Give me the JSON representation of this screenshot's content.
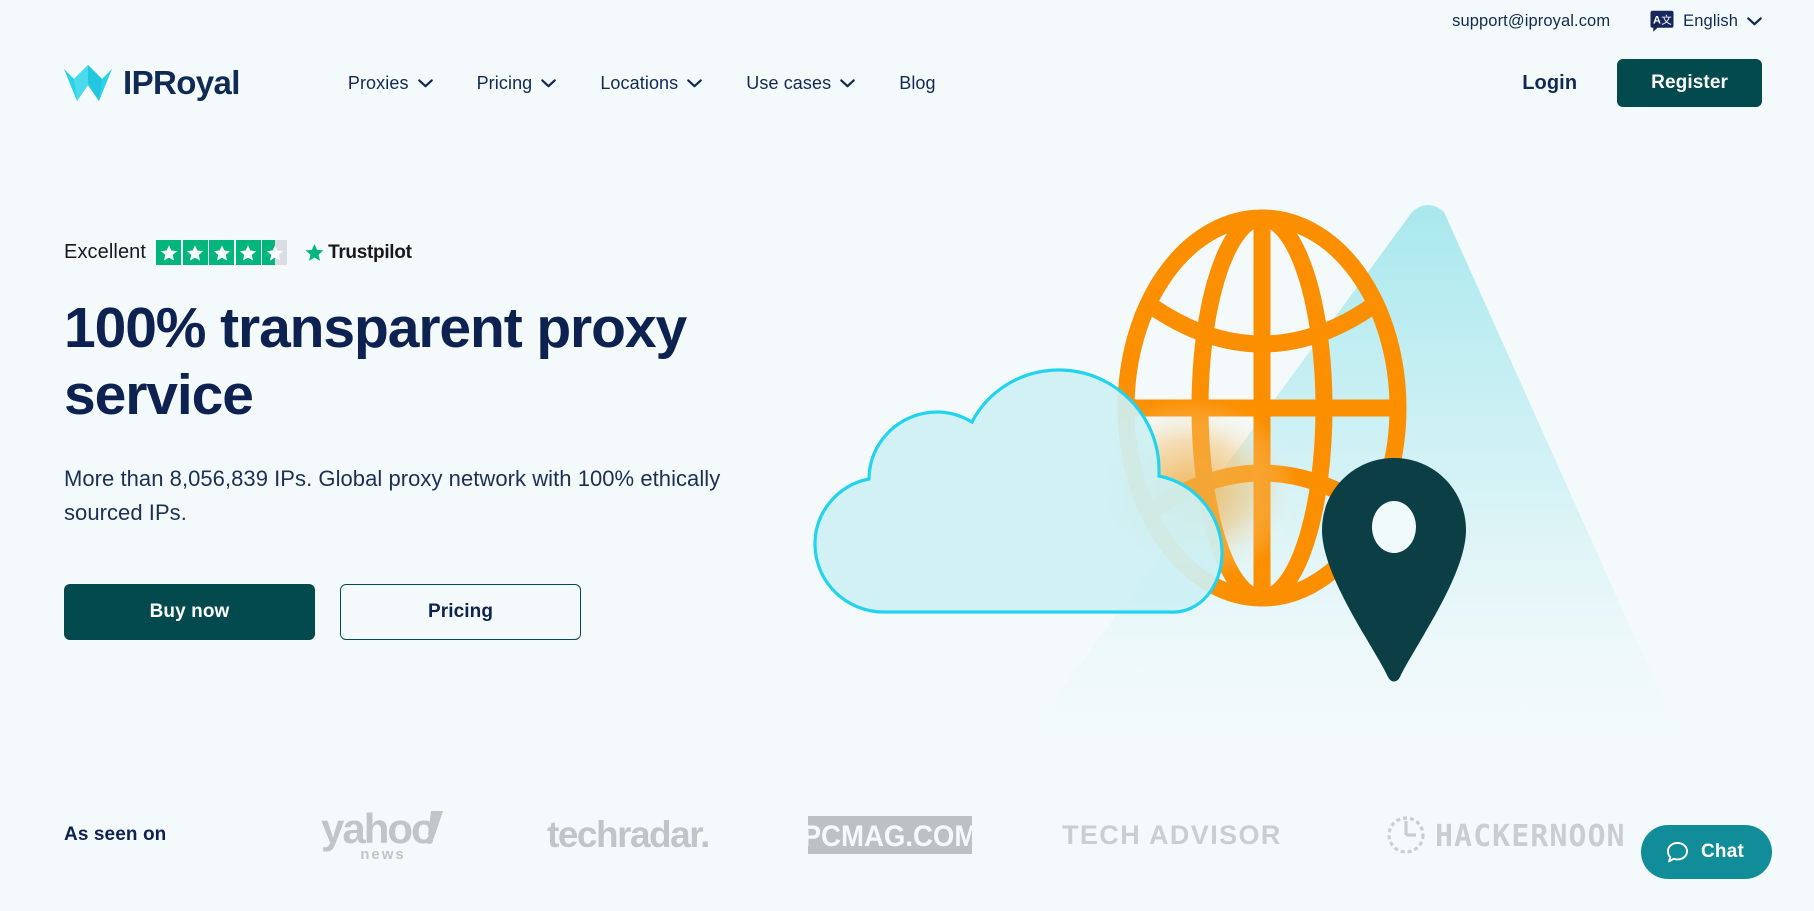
{
  "topbar": {
    "support_email": "support@iproyal.com",
    "language": "English",
    "language_icon": "translate-icon",
    "chevron_icon": "chevron-down-icon"
  },
  "brand": {
    "name": "IPRoyal",
    "mark_icon": "iproyal-crown-logo"
  },
  "nav": {
    "items": [
      {
        "label": "Proxies",
        "has_dropdown": true
      },
      {
        "label": "Pricing",
        "has_dropdown": true
      },
      {
        "label": "Locations",
        "has_dropdown": true
      },
      {
        "label": "Use cases",
        "has_dropdown": true
      },
      {
        "label": "Blog",
        "has_dropdown": false
      }
    ],
    "login_label": "Login",
    "register_label": "Register"
  },
  "hero": {
    "trustpilot": {
      "rating_word": "Excellent",
      "stars_filled": 4,
      "stars_total": 5,
      "has_half_star": true,
      "brand": "Trustpilot"
    },
    "headline": "100% transparent proxy service",
    "subhead": "More than 8,056,839 IPs. Global proxy network with 100% ethically sourced IPs.",
    "primary_cta": "Buy now",
    "secondary_cta": "Pricing"
  },
  "seen_on": {
    "label": "As seen on",
    "logos": [
      {
        "name": "yahoo-news",
        "text": "yahoo!",
        "sub": "news"
      },
      {
        "name": "techradar",
        "text": "techradar."
      },
      {
        "name": "pcmag",
        "text": "PCMAG.COM"
      },
      {
        "name": "tech-advisor",
        "text": "TECH ADVISOR"
      },
      {
        "name": "hackernoon",
        "text": "HACKERNOON"
      }
    ]
  },
  "chat": {
    "label": "Chat",
    "icon": "chat-bubble-icon"
  },
  "colors": {
    "page_background": "#f4fafb",
    "navy": "#0d2250",
    "dark_teal": "#034a4e",
    "cyan": "#22d3ee",
    "orange": "#fb8f00",
    "trustpilot_green": "#00b67a",
    "chat_teal": "#118c99",
    "press_grey": "#c3c8ca"
  }
}
